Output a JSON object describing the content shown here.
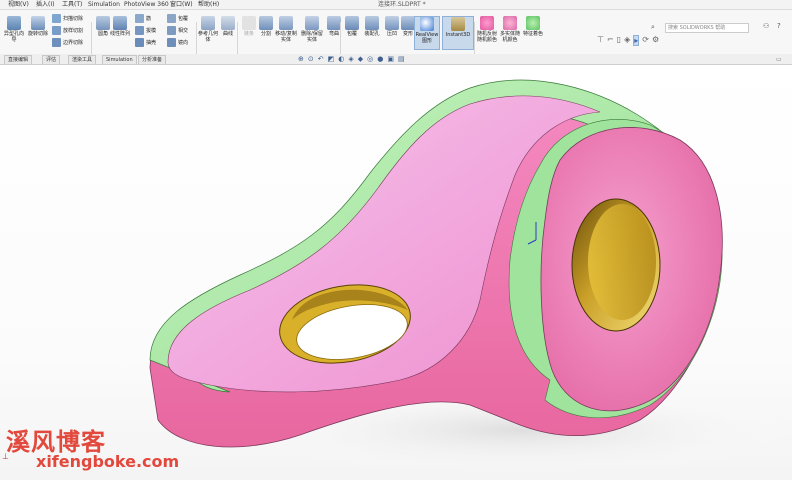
{
  "menu": {
    "items": [
      "视图(V)",
      "插入(I)",
      "工具(T)",
      "Simulation",
      "PhotoView 360",
      "窗口(W)",
      "帮助(H)"
    ],
    "title": "连接环.SLDPRT *"
  },
  "ribbon": {
    "hole_wizard": "异型孔向导",
    "revolve_cut": "旋转切除",
    "swept_cut": "扫描切除",
    "lofted_cut": "放样切割",
    "boundary_cut": "边界切除",
    "fillet": "圆角",
    "linear_pattern": "线性阵列",
    "rib": "筋",
    "draft": "拔模",
    "shell": "抽壳",
    "wrap": "包覆",
    "intersect": "相交",
    "mirror": "镜向",
    "ref_geometry": "参考几何体",
    "curves": "曲线",
    "instant3d_disabled": "链条",
    "split": "分割",
    "move_copy": "移动/复制实体",
    "delete_keep": "删除/保留实体",
    "flex": "弯曲",
    "wrap2": "包覆",
    "hole_series": "装配孔",
    "indent": "压凹",
    "deform": "变形",
    "realview": "RealView 图形",
    "instant3d": "Instant3D",
    "ee_1": "随机反射随机颜色",
    "ee_2": "多实体随机颜色",
    "ee_3": "特征着色"
  },
  "search": {
    "placeholder": "搜索 SOLIDWORKS 帮助"
  },
  "tabs": [
    "直接编辑",
    "评估",
    "渲染工具",
    "Simulation",
    "分析准备"
  ],
  "watermark": {
    "cn": "溪风博客",
    "url": "xifengboke.com"
  },
  "colors": {
    "part_pink": "#f07ab8",
    "rim_green": "#a8e8a0",
    "hole_gold": "#c8a020"
  }
}
